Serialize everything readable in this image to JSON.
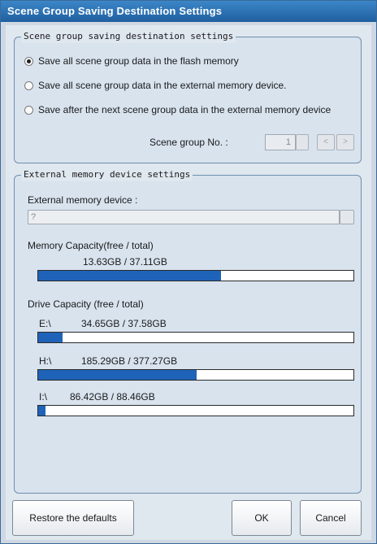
{
  "window": {
    "title": "Scene Group Saving Destination Settings"
  },
  "saving_group": {
    "legend": "Scene group saving destination settings",
    "options": [
      {
        "label": "Save all scene group data in the flash memory",
        "checked": true
      },
      {
        "label": "Save all scene group data in the external memory device.",
        "checked": false
      },
      {
        "label": "Save after the next scene group data in the external memory device",
        "checked": false
      }
    ],
    "scene_group_label": "Scene group No. :",
    "scene_group_value": "1",
    "prev_symbol": "<",
    "next_symbol": ">"
  },
  "external_group": {
    "legend": "External memory device settings",
    "device_label": "External memory device :",
    "device_value": "?",
    "memory_capacity_label": "Memory Capacity(free / total)",
    "memory_capacity_value": "13.63GB / 37.11GB",
    "memory_capacity_fraction": 0.58,
    "drive_capacity_label": "Drive Capacity (free / total)",
    "drives": [
      {
        "name": "E:\\",
        "value": "34.65GB / 37.58GB",
        "fraction": 0.078
      },
      {
        "name": "H:\\",
        "value": "185.29GB / 377.27GB",
        "fraction": 0.503
      },
      {
        "name": "I:\\",
        "value": "86.42GB / 88.46GB",
        "fraction": 0.023
      }
    ]
  },
  "buttons": {
    "restore_label": "Restore the defaults",
    "ok_label": "OK",
    "cancel_label": "Cancel"
  },
  "colors": {
    "title_bar": "#2a70b3",
    "bar_fill": "#1f63b8",
    "panel": "#d8e3ee"
  }
}
